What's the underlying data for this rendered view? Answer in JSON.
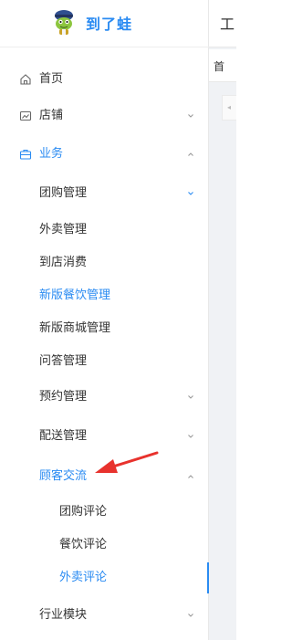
{
  "brand": {
    "name": "到了蛙",
    "logo_icon": "frog-mascot-icon"
  },
  "sidebar": {
    "items": [
      {
        "label": "首页",
        "icon": "home-icon"
      },
      {
        "label": "店铺",
        "icon": "store-icon",
        "chevron": "down"
      },
      {
        "label": "业务",
        "icon": "briefcase-icon",
        "chevron": "up",
        "active": true
      },
      {
        "label": "团购管理",
        "chevron": "down"
      },
      {
        "label": "外卖管理"
      },
      {
        "label": "到店消费"
      },
      {
        "label": "新版餐饮管理",
        "active": true
      },
      {
        "label": "新版商城管理"
      },
      {
        "label": "问答管理"
      },
      {
        "label": "预约管理",
        "chevron": "down"
      },
      {
        "label": "配送管理",
        "chevron": "down"
      },
      {
        "label": "顾客交流",
        "chevron": "up",
        "active": true
      },
      {
        "label": "团购评论"
      },
      {
        "label": "餐饮评论"
      },
      {
        "label": "外卖评论",
        "active": true,
        "selected": true
      },
      {
        "label": "行业模块",
        "chevron": "down"
      }
    ]
  },
  "content": {
    "top_glyph": "工",
    "tab_label": "首"
  },
  "colors": {
    "accent": "#2a8bf2",
    "annotation": "#e8322d",
    "text": "#333333",
    "chevron": "#999999"
  }
}
